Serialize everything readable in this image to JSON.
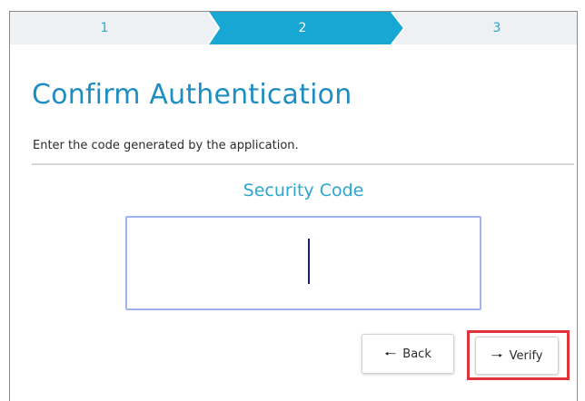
{
  "stepper": {
    "steps": [
      {
        "label": "1",
        "state": "done"
      },
      {
        "label": "2",
        "state": "active"
      },
      {
        "label": "3",
        "state": "pending"
      }
    ],
    "active_color": "#18a7d2",
    "inactive_color": "#eef1f4"
  },
  "page": {
    "title": "Confirm Authentication",
    "subtitle": "Enter the code generated by the application."
  },
  "security_code": {
    "label": "Security Code",
    "value": ""
  },
  "buttons": {
    "back_label": "Back",
    "back_icon": "arrow-left-icon",
    "verify_label": "Verify",
    "verify_icon": "arrow-right-icon"
  },
  "highlight": {
    "target": "verify-button",
    "color": "#e2323a"
  }
}
